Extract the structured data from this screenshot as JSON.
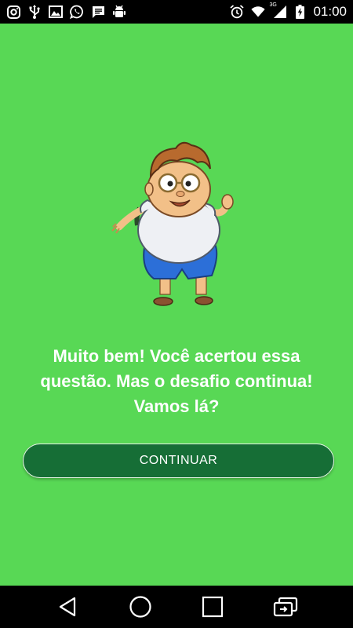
{
  "status_bar": {
    "left_icons": [
      "instagram-icon",
      "usb-icon",
      "image-icon",
      "whatsapp-icon",
      "message-icon",
      "android-debug-icon"
    ],
    "right_icons": [
      "alarm-icon",
      "wifi-icon",
      "signal-icon",
      "battery-charging-icon"
    ],
    "network_type": "3G",
    "time": "01:00"
  },
  "screen": {
    "background_color": "#58d855",
    "mascot": "boy-waving-illustration",
    "message": "Muito bem! Você acertou essa questão. Mas o desafio continua! Vamos lá?",
    "continue_button": {
      "label": "CONTINUAR",
      "color": "#166e36"
    }
  },
  "navigation_bar": {
    "buttons": [
      "back-icon",
      "home-icon",
      "recents-icon",
      "rotate-screen-icon"
    ]
  }
}
